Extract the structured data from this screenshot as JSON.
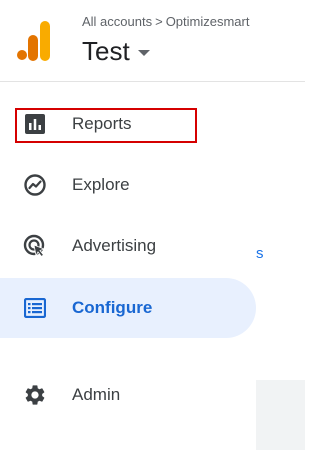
{
  "header": {
    "breadcrumb": [
      "All accounts",
      ">",
      "Optimizesmart"
    ],
    "title": "Test"
  },
  "nav": {
    "items": [
      {
        "label": "Reports",
        "icon": "bar-chart-icon"
      },
      {
        "label": "Explore",
        "icon": "explore-icon"
      },
      {
        "label": "Advertising",
        "icon": "advertising-icon"
      },
      {
        "label": "Configure",
        "icon": "configure-icon",
        "active": true
      },
      {
        "label": "Admin",
        "icon": "gear-icon"
      }
    ]
  },
  "colors": {
    "accent": "#1967d2",
    "active_bg": "#e8f0fe",
    "highlight": "#d50000",
    "logo_orange": "#f9ab00",
    "logo_dark_orange": "#e37400"
  },
  "background": {
    "partial_text": "s"
  }
}
